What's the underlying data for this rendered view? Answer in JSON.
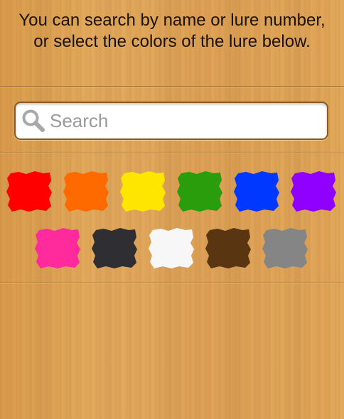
{
  "instructions": "You can search by name or lure number, or select the colors of the lure below.",
  "search": {
    "placeholder": "Search",
    "value": ""
  },
  "colors": {
    "row1": [
      {
        "name": "red",
        "hex": "#ff0000"
      },
      {
        "name": "orange",
        "hex": "#ff6a00"
      },
      {
        "name": "yellow",
        "hex": "#ffe600"
      },
      {
        "name": "green",
        "hex": "#2a9d0c"
      },
      {
        "name": "blue",
        "hex": "#0038ff"
      },
      {
        "name": "purple",
        "hex": "#8f00ff"
      }
    ],
    "row2": [
      {
        "name": "pink",
        "hex": "#ff2a9c"
      },
      {
        "name": "black",
        "hex": "#2f2f33"
      },
      {
        "name": "white",
        "hex": "#f7f7f7"
      },
      {
        "name": "brown",
        "hex": "#5a3512"
      },
      {
        "name": "gray",
        "hex": "#858585"
      }
    ]
  }
}
